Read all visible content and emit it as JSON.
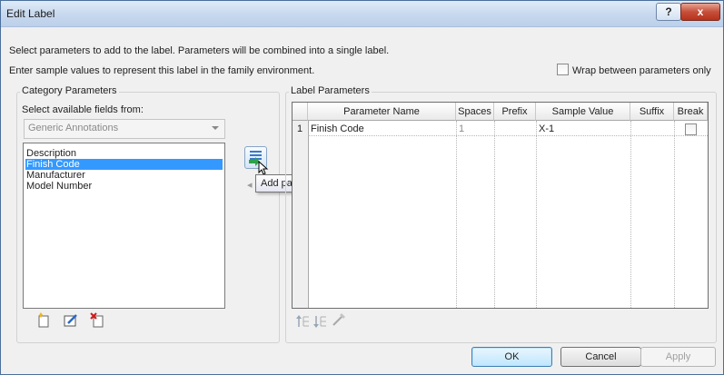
{
  "window": {
    "title": "Edit Label",
    "help": "?",
    "close": "x"
  },
  "intro": {
    "line1": "Select parameters to add to the label.  Parameters will be combined into a single label.",
    "line2": "Enter sample values to represent this label in the family environment."
  },
  "wrap_option": {
    "label": "Wrap between parameters only",
    "checked": false
  },
  "category": {
    "title": "Category Parameters",
    "fields_label": "Select available fields from:",
    "selected_category": "Generic Annotations",
    "items": [
      "Description",
      "Finish Code",
      "Manufacturer",
      "Model Number"
    ],
    "selected_index": 1
  },
  "tooltip": "Add parameter(s) to label",
  "label_params": {
    "title": "Label Parameters",
    "columns": [
      "Parameter Name",
      "Spaces",
      "Prefix",
      "Sample Value",
      "Suffix",
      "Break"
    ],
    "rows": [
      {
        "index": "1",
        "name": "Finish Code",
        "spaces": "1",
        "prefix": "",
        "sample": "X-1",
        "suffix": "",
        "break": false
      }
    ]
  },
  "buttons": {
    "ok": "OK",
    "cancel": "Cancel",
    "apply": "Apply"
  }
}
